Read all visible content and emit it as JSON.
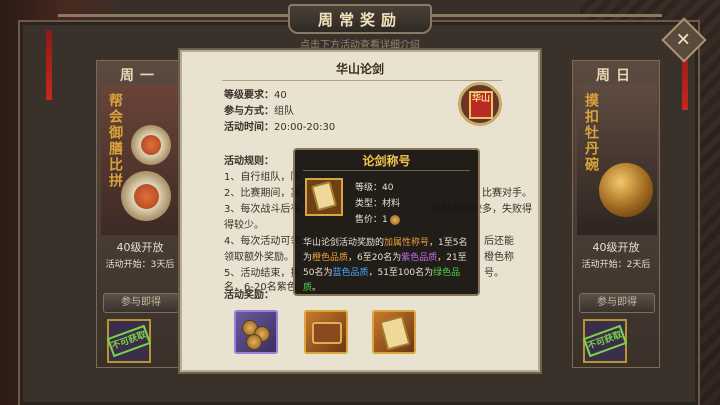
{
  "title": "周常奖励",
  "subheader": "点击下方活动查看详细介绍",
  "left_card": {
    "day": "周一",
    "art_text": "帮会御膳比拼",
    "level": "40级开放",
    "start": "活动开始：3天后",
    "join_label": "参与即得",
    "stamp": "不可获取"
  },
  "right_card": {
    "day": "周日",
    "art_text": "摸扣牡丹碗",
    "level": "40级开放",
    "start": "活动开始：2天后",
    "join_label": "参与即得",
    "stamp": "不可获取"
  },
  "panel": {
    "title": "华山论剑",
    "level_req_key": "等级要求：",
    "level_req_val": "40",
    "mode_key": "参与方式：",
    "mode_val": "组队",
    "time_key": "活动时间：",
    "time_val": "20:00-20:30",
    "rules_title": "活动规则：",
    "rules": [
      "1、自行组队，队",
      "2、比赛期间，其",
      "3、每次战斗后有",
      "4、每次活动可领",
      "5、活动结束，排",
      "名，6-20名紫色"
    ],
    "rules_right": [
      "比赛对手。",
      "胜利获得较多，失败得",
      "后还能",
      "橙色称",
      "号。"
    ],
    "rules_line3_tail": "得较少。",
    "rules_line4_tail": "领取额外奖励。",
    "rewards_title": "活动奖励：",
    "badge_text": "华山"
  },
  "tooltip": {
    "title": "论剑称号",
    "level": "等级：40",
    "type": "类型：材料",
    "price_label": "售价：1",
    "desc_1": "华山论剑活动奖励的",
    "desc_attr": "加属性称号",
    "desc_2": "，1至5名为",
    "desc_orange": "橙色品质",
    "desc_3": "，6至20名为",
    "desc_purple": "紫色品质",
    "desc_4": "，21至50名为",
    "desc_blue": "蓝色品质",
    "desc_5": "，51至100名为",
    "desc_green": "绿色品质",
    "desc_6": "。"
  }
}
